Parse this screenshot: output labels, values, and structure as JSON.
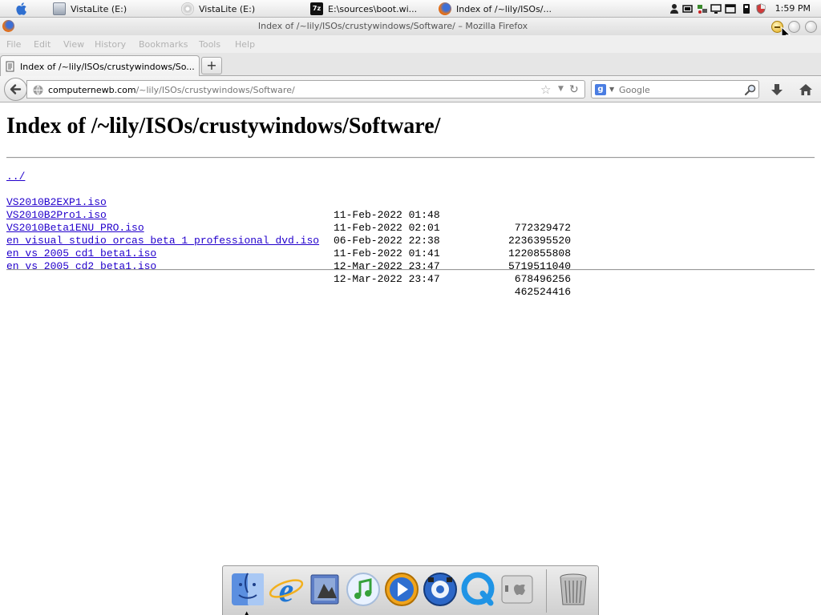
{
  "menubar": {
    "tasks": [
      {
        "label": "VistaLite (E:)",
        "icon": "drive-icon"
      },
      {
        "label": "VistaLite (E:)",
        "icon": "disc-icon"
      },
      {
        "label": "E:\\sources\\boot.wi...",
        "icon": "7zip-icon"
      },
      {
        "label": "Index of /~lily/ISOs/...",
        "icon": "firefox-icon"
      }
    ],
    "clock": "1:59 PM"
  },
  "window": {
    "title": "Index of /~lily/ISOs/crustywindows/Software/ – Mozilla Firefox"
  },
  "app_menu": [
    "File",
    "Edit",
    "View",
    "History",
    "Bookmarks",
    "Tools",
    "Help"
  ],
  "tabs": {
    "active_label": "Index of /~lily/ISOs/crustywindows/So...",
    "new_tab_label": "+"
  },
  "navbar": {
    "url_host": "computernewb.com",
    "url_path": "/~lily/ISOs/crustywindows/Software/",
    "search_engine_letter": "g",
    "search_placeholder": "Google"
  },
  "page": {
    "title": "Index of /~lily/ISOs/crustywindows/Software/",
    "parent_link": "../",
    "entries": [
      {
        "name": "VS2010B2EXP1.iso",
        "date": "11-Feb-2022 01:48",
        "size": "772329472"
      },
      {
        "name": "VS2010B2Pro1.iso",
        "date": "11-Feb-2022 02:01",
        "size": "2236395520"
      },
      {
        "name": "VS2010Beta1ENU_PRO.iso",
        "date": "06-Feb-2022 22:38",
        "size": "1220855808"
      },
      {
        "name": "en_visual_studio_orcas_beta_1_professional_dvd.iso",
        "date": "11-Feb-2022 01:41",
        "size": "5719511040"
      },
      {
        "name": "en_vs_2005_cd1_beta1.iso",
        "date": "12-Mar-2022 23:47",
        "size": "678496256"
      },
      {
        "name": "en_vs_2005_cd2_beta1.iso",
        "date": "12-Mar-2022 23:47",
        "size": "462524416"
      }
    ]
  },
  "dock": {
    "items": [
      "finder-icon",
      "internet-explorer-icon",
      "mail-icon",
      "itunes-icon",
      "media-player-icon",
      "quicktime-x-icon",
      "quicktime-icon",
      "boot-camp-icon",
      "trash-icon"
    ]
  },
  "colors": {
    "link": "#2200cc",
    "minimize_button": "#e3a80c"
  }
}
